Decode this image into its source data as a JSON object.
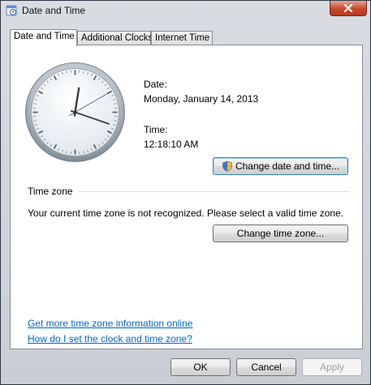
{
  "window": {
    "title": "Date and Time"
  },
  "tabs": [
    {
      "label": "Date and Time",
      "active": true
    },
    {
      "label": "Additional Clocks",
      "active": false
    },
    {
      "label": "Internet Time",
      "active": false
    }
  ],
  "clock": {
    "hour": 12,
    "minute": 18,
    "second": 10
  },
  "date": {
    "label": "Date:",
    "value": "Monday, January 14, 2013"
  },
  "time": {
    "label": "Time:",
    "value": "12:18:10 AM"
  },
  "change_date_button": "Change date and time...",
  "timezone": {
    "heading": "Time zone",
    "message": "Your current time zone is not recognized. Please select a valid time zone.",
    "change_button": "Change time zone..."
  },
  "links": {
    "more_info": "Get more time zone information online",
    "how_to": "How do I set the clock and time zone?"
  },
  "footer": {
    "ok": "OK",
    "cancel": "Cancel",
    "apply": "Apply"
  },
  "icons": {
    "title": "date-time-icon",
    "close": "close-icon",
    "shield": "uac-shield-icon"
  }
}
